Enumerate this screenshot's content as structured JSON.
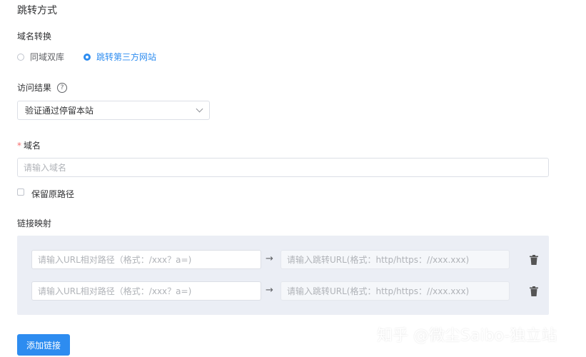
{
  "page": {
    "title": "跳转方式"
  },
  "domain_convert": {
    "label": "域名转换",
    "options": [
      {
        "label": "同域双库",
        "checked": false
      },
      {
        "label": "跳转第三方网站",
        "checked": true
      }
    ]
  },
  "visit_result": {
    "label": "访问结果",
    "help_icon": "question-circle-icon",
    "help_glyph": "?",
    "selected": "验证通过停留本站"
  },
  "domain": {
    "required_mark": "*",
    "label": "域名",
    "placeholder": "请输入域名"
  },
  "keep_path": {
    "label": "保留原路径",
    "checked": false
  },
  "link_mapping": {
    "label": "链接映射",
    "arrow": "→",
    "rows": [
      {
        "source_placeholder": "请输入URL相对路径（格式：/xxx？a=)",
        "target_placeholder": "请输入跳转URL(格式：http/https：//xxx.xxx)"
      },
      {
        "source_placeholder": "请输入URL相对路径（格式：/xxx？a=)",
        "target_placeholder": "请输入跳转URL(格式：http/https：//xxx.xxx)"
      }
    ]
  },
  "add_button": {
    "label": "添加链接"
  },
  "watermark": {
    "text": "知乎 @微尘Saibo-独立站"
  },
  "colors": {
    "accent": "#2d8cf0",
    "mapping_bg": "#ebeef5"
  }
}
